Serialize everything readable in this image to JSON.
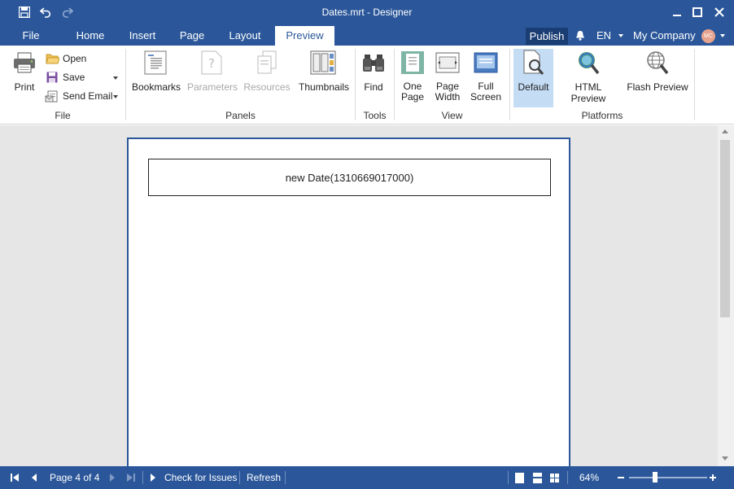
{
  "titlebar": {
    "title": "Dates.mrt - Designer"
  },
  "tabs": [
    "File",
    "Home",
    "Insert",
    "Page",
    "Layout",
    "Preview"
  ],
  "header_right": {
    "publish": "Publish",
    "language": "EN",
    "company": "My Company",
    "avatar_initials": "MC"
  },
  "ribbon": {
    "file": {
      "print": "Print",
      "open": "Open",
      "save": "Save",
      "send_email": "Send Email",
      "label": "File"
    },
    "panels": {
      "bookmarks": "Bookmarks",
      "parameters": "Parameters",
      "resources": "Resources",
      "thumbnails": "Thumbnails",
      "label": "Panels"
    },
    "tools": {
      "find": "Find",
      "label": "Tools"
    },
    "view": {
      "one_page_1": "One",
      "one_page_2": "Page",
      "page_width_1": "Page",
      "page_width_2": "Width",
      "full_screen_1": "Full",
      "full_screen_2": "Screen",
      "label": "View"
    },
    "platforms": {
      "default": "Default",
      "html_preview": "HTML Preview",
      "flash_preview": "Flash Preview",
      "label": "Platforms"
    }
  },
  "document": {
    "text": "new Date(1310669017000)"
  },
  "statusbar": {
    "page_info": "Page 4 of 4",
    "check_issues": "Check for Issues",
    "refresh": "Refresh",
    "zoom": "64%",
    "zoom_level": 0.64
  },
  "colors": {
    "accent": "#2b579a",
    "selected": "#c5dcf5"
  }
}
